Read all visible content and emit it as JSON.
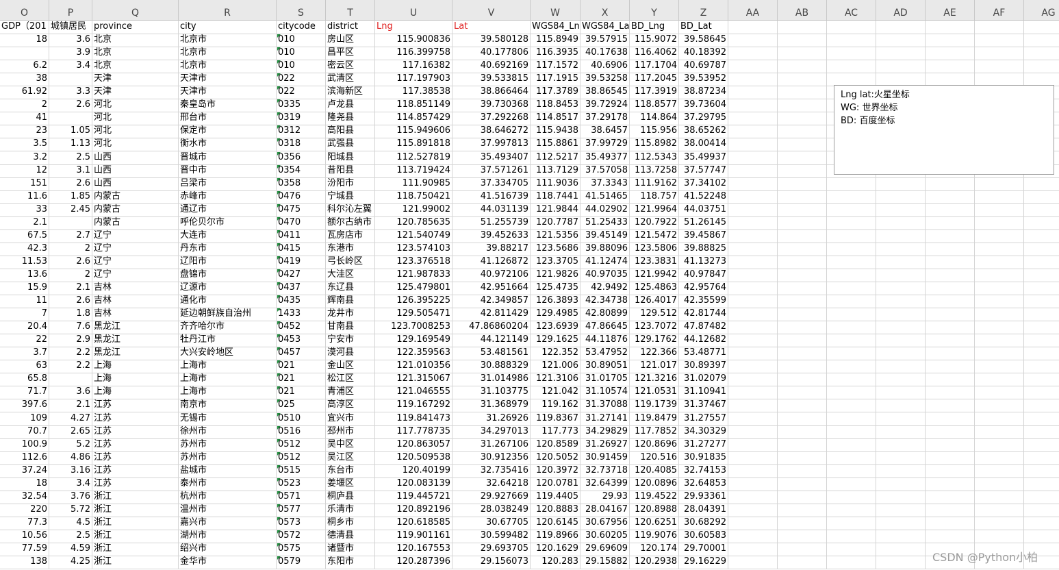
{
  "columns": [
    "O",
    "P",
    "Q",
    "R",
    "S",
    "T",
    "U",
    "V",
    "W",
    "X",
    "Y",
    "Z",
    "AA",
    "AB",
    "AC",
    "AD",
    "AE",
    "AF",
    "AG"
  ],
  "header_row": [
    "GDP（201",
    "城镇居民",
    "province",
    "city",
    "citycode",
    "district",
    "Lng",
    "Lat",
    "WGS84_Ln",
    "WGS84_La",
    "BD_Lng",
    "BD_Lat",
    "",
    "",
    "",
    "",
    "",
    "",
    ""
  ],
  "rows": [
    [
      "18",
      "3.6",
      "北京",
      "北京市",
      "010",
      "房山区",
      "115.900836",
      "39.580128",
      "115.8949",
      "39.57915",
      "115.9072",
      "39.58645"
    ],
    [
      "",
      "3.9",
      "北京",
      "北京市",
      "010",
      "昌平区",
      "116.399758",
      "40.177806",
      "116.3935",
      "40.17638",
      "116.4062",
      "40.18392"
    ],
    [
      "6.2",
      "3.4",
      "北京",
      "北京市",
      "010",
      "密云区",
      "117.16382",
      "40.692169",
      "117.1572",
      "40.6906",
      "117.1704",
      "40.69787"
    ],
    [
      "38",
      "",
      "天津",
      "天津市",
      "022",
      "武清区",
      "117.197903",
      "39.533815",
      "117.1915",
      "39.53258",
      "117.2045",
      "39.53952"
    ],
    [
      "61.92",
      "3.3",
      "天津",
      "天津市",
      "022",
      "滨海新区",
      "117.38538",
      "38.866464",
      "117.3789",
      "38.86545",
      "117.3919",
      "38.87234"
    ],
    [
      "2",
      "2.6",
      "河北",
      "秦皇岛市",
      "0335",
      "卢龙县",
      "118.851149",
      "39.730368",
      "118.8453",
      "39.72924",
      "118.8577",
      "39.73604"
    ],
    [
      "41",
      "",
      "河北",
      "邢台市",
      "0319",
      "隆尧县",
      "114.857429",
      "37.292268",
      "114.8517",
      "37.29178",
      "114.864",
      "37.29795"
    ],
    [
      "23",
      "1.05",
      "河北",
      "保定市",
      "0312",
      "高阳县",
      "115.949606",
      "38.646272",
      "115.9438",
      "38.6457",
      "115.956",
      "38.65262"
    ],
    [
      "3.5",
      "1.13",
      "河北",
      "衡水市",
      "0318",
      "武强县",
      "115.891818",
      "37.997813",
      "115.8861",
      "37.99729",
      "115.8982",
      "38.00414"
    ],
    [
      "3.2",
      "2.5",
      "山西",
      "晋城市",
      "0356",
      "阳城县",
      "112.527819",
      "35.493407",
      "112.5217",
      "35.49377",
      "112.5343",
      "35.49937"
    ],
    [
      "12",
      "3.1",
      "山西",
      "晋中市",
      "0354",
      "昔阳县",
      "113.719424",
      "37.571261",
      "113.7129",
      "37.57058",
      "113.7258",
      "37.57747"
    ],
    [
      "151",
      "2.6",
      "山西",
      "吕梁市",
      "0358",
      "汾阳市",
      "111.90985",
      "37.334705",
      "111.9036",
      "37.3343",
      "111.9162",
      "37.34102"
    ],
    [
      "11.6",
      "1.85",
      "内蒙古",
      "赤峰市",
      "0476",
      "宁城县",
      "118.750421",
      "41.516739",
      "118.7441",
      "41.51465",
      "118.757",
      "41.52248"
    ],
    [
      "33",
      "2.45",
      "内蒙古",
      "通辽市",
      "0475",
      "科尔沁左翼",
      "121.99002",
      "44.031139",
      "121.9844",
      "44.02902",
      "121.9964",
      "44.03751"
    ],
    [
      "2.1",
      "",
      "内蒙古",
      "呼伦贝尔市",
      "0470",
      "额尔古纳市",
      "120.785635",
      "51.255739",
      "120.7787",
      "51.25433",
      "120.7922",
      "51.26145"
    ],
    [
      "67.5",
      "2.7",
      "辽宁",
      "大连市",
      "0411",
      "瓦房店市",
      "121.540749",
      "39.452633",
      "121.5356",
      "39.45149",
      "121.5472",
      "39.45867"
    ],
    [
      "42.3",
      "2",
      "辽宁",
      "丹东市",
      "0415",
      "东港市",
      "123.574103",
      "39.88217",
      "123.5686",
      "39.88096",
      "123.5806",
      "39.88825"
    ],
    [
      "11.53",
      "2.6",
      "辽宁",
      "辽阳市",
      "0419",
      "弓长岭区",
      "123.376518",
      "41.126872",
      "123.3705",
      "41.12474",
      "123.3831",
      "41.13273"
    ],
    [
      "13.6",
      "2",
      "辽宁",
      "盘锦市",
      "0427",
      "大洼区",
      "121.987833",
      "40.972106",
      "121.9826",
      "40.97035",
      "121.9942",
      "40.97847"
    ],
    [
      "15.9",
      "2.1",
      "吉林",
      "辽源市",
      "0437",
      "东辽县",
      "125.479801",
      "42.951664",
      "125.4735",
      "42.9492",
      "125.4863",
      "42.95764"
    ],
    [
      "11",
      "2.6",
      "吉林",
      "通化市",
      "0435",
      "辉南县",
      "126.395225",
      "42.349857",
      "126.3893",
      "42.34738",
      "126.4017",
      "42.35599"
    ],
    [
      "7",
      "1.8",
      "吉林",
      "延边朝鲜族自治州",
      "1433",
      "龙井市",
      "129.505471",
      "42.811429",
      "129.4985",
      "42.80899",
      "129.512",
      "42.81744"
    ],
    [
      "20.4",
      "7.6",
      "黑龙江",
      "齐齐哈尔市",
      "0452",
      "甘南县",
      "123.7008253",
      "47.86860204",
      "123.6939",
      "47.86645",
      "123.7072",
      "47.87482"
    ],
    [
      "22",
      "2.9",
      "黑龙江",
      "牡丹江市",
      "0453",
      "宁安市",
      "129.169549",
      "44.121149",
      "129.1625",
      "44.11876",
      "129.1762",
      "44.12682"
    ],
    [
      "3.7",
      "2.2",
      "黑龙江",
      "大兴安岭地区",
      "0457",
      "漠河县",
      "122.359563",
      "53.481561",
      "122.352",
      "53.47952",
      "122.366",
      "53.48771"
    ],
    [
      "63",
      "2.2",
      "上海",
      "上海市",
      "021",
      "金山区",
      "121.010356",
      "30.888329",
      "121.006",
      "30.89051",
      "121.017",
      "30.89397"
    ],
    [
      "65.8",
      "",
      "上海",
      "上海市",
      "021",
      "松江区",
      "121.315067",
      "31.014986",
      "121.3106",
      "31.01705",
      "121.3216",
      "31.02079"
    ],
    [
      "71.7",
      "3.6",
      "上海",
      "上海市",
      "021",
      "青浦区",
      "121.046555",
      "31.103775",
      "121.042",
      "31.10574",
      "121.0531",
      "31.10941"
    ],
    [
      "397.6",
      "2.1",
      "江苏",
      "南京市",
      "025",
      "高淳区",
      "119.167292",
      "31.368979",
      "119.162",
      "31.37088",
      "119.1739",
      "31.37467"
    ],
    [
      "109",
      "4.27",
      "江苏",
      "无锡市",
      "0510",
      "宜兴市",
      "119.841473",
      "31.26926",
      "119.8367",
      "31.27141",
      "119.8479",
      "31.27557"
    ],
    [
      "70.7",
      "2.65",
      "江苏",
      "徐州市",
      "0516",
      "邳州市",
      "117.778735",
      "34.297013",
      "117.773",
      "34.29829",
      "117.7852",
      "34.30329"
    ],
    [
      "100.9",
      "5.2",
      "江苏",
      "苏州市",
      "0512",
      "吴中区",
      "120.863057",
      "31.267106",
      "120.8589",
      "31.26927",
      "120.8696",
      "31.27277"
    ],
    [
      "112.6",
      "4.86",
      "江苏",
      "苏州市",
      "0512",
      "吴江区",
      "120.509538",
      "30.912356",
      "120.5052",
      "30.91459",
      "120.516",
      "30.91835"
    ],
    [
      "37.24",
      "3.16",
      "江苏",
      "盐城市",
      "0515",
      "东台市",
      "120.40199",
      "32.735416",
      "120.3972",
      "32.73718",
      "120.4085",
      "32.74153"
    ],
    [
      "18",
      "3.4",
      "江苏",
      "泰州市",
      "0523",
      "姜堰区",
      "120.083139",
      "32.64218",
      "120.0781",
      "32.64399",
      "120.0896",
      "32.64853"
    ],
    [
      "32.54",
      "3.76",
      "浙江",
      "杭州市",
      "0571",
      "桐庐县",
      "119.445721",
      "29.927669",
      "119.4405",
      "29.93",
      "119.4522",
      "29.93361"
    ],
    [
      "220",
      "5.72",
      "浙江",
      "温州市",
      "0577",
      "乐清市",
      "120.892196",
      "28.038249",
      "120.8883",
      "28.04167",
      "120.8988",
      "28.04391"
    ],
    [
      "77.3",
      "4.5",
      "浙江",
      "嘉兴市",
      "0573",
      "桐乡市",
      "120.618585",
      "30.67705",
      "120.6145",
      "30.67956",
      "120.6251",
      "30.68292"
    ],
    [
      "10.56",
      "2.5",
      "浙江",
      "湖州市",
      "0572",
      "德清县",
      "119.901161",
      "30.599482",
      "119.8966",
      "30.60205",
      "119.9076",
      "30.60583"
    ],
    [
      "77.59",
      "4.59",
      "浙江",
      "绍兴市",
      "0575",
      "诸暨市",
      "120.167553",
      "29.693705",
      "120.1629",
      "29.69609",
      "120.174",
      "29.70001"
    ],
    [
      "138",
      "4.25",
      "浙江",
      "金华市",
      "0579",
      "东阳市",
      "120.287396",
      "29.156073",
      "120.283",
      "29.15882",
      "120.2938",
      "29.16229"
    ]
  ],
  "note": {
    "line1": "Lng  lat:火星坐标",
    "line2": "WG:  世界坐标",
    "line3": "BD:  百度坐标"
  },
  "watermark": "CSDN @Python小柏"
}
